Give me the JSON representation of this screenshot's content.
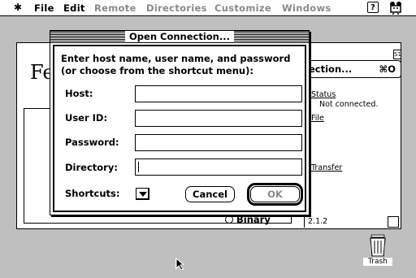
{
  "menubar": {
    "apple_glyph": "✱",
    "items": [
      "File",
      "Edit",
      "Remote",
      "Directories",
      "Customize",
      "Windows"
    ],
    "help_glyph": "?"
  },
  "background_window": {
    "title_fragment": "Fe",
    "shortcut_button_label": "ection...",
    "shortcut_key": "⌘O",
    "status_label": "Status",
    "status_value": "Not connected.",
    "file_label": "File",
    "transfer_label": "Transfer",
    "binary_label": "Binary",
    "version": "2.1.2"
  },
  "dialog": {
    "title": "Open Connection...",
    "instruction_line1": "Enter host name, user name, and password",
    "instruction_line2": "(or choose from the shortcut menu):",
    "fields": {
      "host": {
        "label": "Host:",
        "value": ""
      },
      "user_id": {
        "label": "User ID:",
        "value": ""
      },
      "password": {
        "label": "Password:",
        "value": ""
      },
      "directory": {
        "label": "Directory:",
        "value": ""
      }
    },
    "shortcuts_label": "Shortcuts:",
    "cancel_label": "Cancel",
    "ok_label": "OK"
  },
  "desktop": {
    "trash_label": "Trash"
  },
  "icons": {
    "apple": "apple-icon",
    "help": "help-icon",
    "app": "fetch-app-icon",
    "popup": "popup-triangle-icon",
    "trash": "trash-icon",
    "cursor": "arrow-cursor-icon"
  }
}
